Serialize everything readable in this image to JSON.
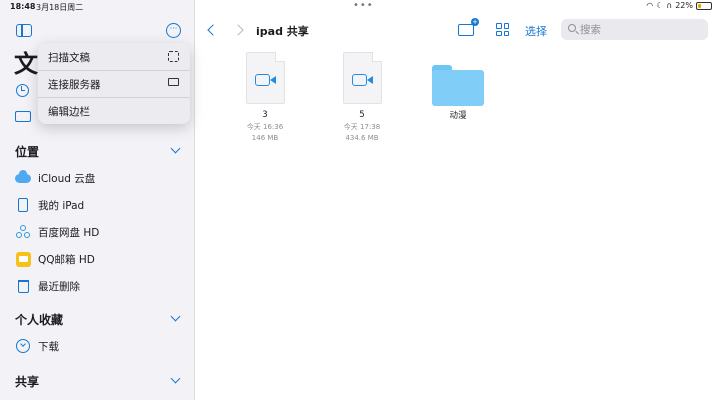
{
  "status_bar": {
    "time": "18:48",
    "date": "3月18日周二",
    "battery": "22%",
    "battery_level": 0.22
  },
  "sidebar": {
    "title_partial": "文",
    "sections": {
      "locations": "位置",
      "favorites": "个人收藏",
      "shared": "共享"
    },
    "locations": [
      {
        "label": "iCloud 云盘",
        "icon": "icloud-icon"
      },
      {
        "label": "我的 iPad",
        "icon": "ipad-icon"
      },
      {
        "label": "百度网盘 HD",
        "icon": "baidu-icon"
      },
      {
        "label": "QQ邮箱 HD",
        "icon": "qqmail-icon"
      },
      {
        "label": "最近删除",
        "icon": "trash-icon"
      }
    ],
    "favorites": [
      {
        "label": "下载",
        "icon": "download-icon"
      }
    ]
  },
  "menu": {
    "items": [
      {
        "label": "扫描文稿",
        "icon": "scan-icon"
      },
      {
        "label": "连接服务器",
        "icon": "monitor-icon"
      },
      {
        "label": "编辑边栏",
        "icon": ""
      }
    ]
  },
  "toolbar": {
    "folder_title": "ipad 共享",
    "select_label": "选择",
    "search_placeholder": "搜索"
  },
  "files": [
    {
      "name": "3",
      "date": "今天 16:36",
      "size": "146 MB",
      "type": "video"
    },
    {
      "name": "5",
      "date": "今天 17:38",
      "size": "434.6 MB",
      "type": "video"
    }
  ],
  "folders": [
    {
      "name": "动漫"
    }
  ],
  "colors": {
    "accent": "#1677d2",
    "folder": "#80cef7"
  }
}
